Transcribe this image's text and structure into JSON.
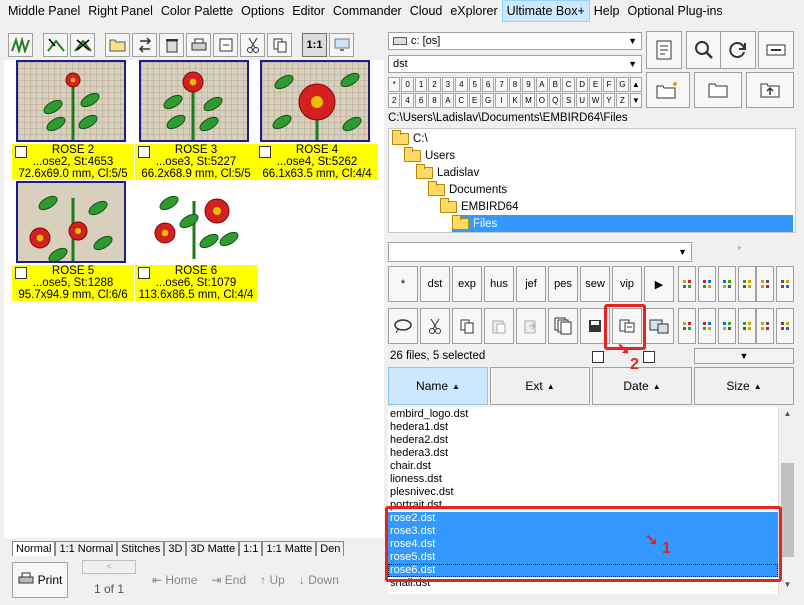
{
  "menu": {
    "items": [
      "Middle Panel",
      "Right Panel",
      "Color Palette",
      "Options",
      "Editor",
      "Commander",
      "Cloud",
      "eXplorer",
      "Ultimate Box+",
      "Help",
      "Optional Plug-ins"
    ],
    "active_index": 8
  },
  "left_toolbar": {
    "zoom_label": "1:1"
  },
  "thumbnails": [
    {
      "title": "ROSE 2",
      "line2": "...ose2, St:4653",
      "line3": "72.6x69.0 mm, Cl:5/5"
    },
    {
      "title": "ROSE 3",
      "line2": "...ose3, St:5227",
      "line3": "66.2x68.9 mm, Cl:5/5"
    },
    {
      "title": "ROSE 4",
      "line2": "...ose4, St:5262",
      "line3": "66.1x63.5 mm, Cl:4/4"
    },
    {
      "title": "ROSE 5",
      "line2": "...ose5, St:1288",
      "line3": "95.7x94.9 mm, Cl:6/6"
    },
    {
      "title": "ROSE 6",
      "line2": "...ose6, St:1079",
      "line3": "113.6x86.5 mm, Cl:4/4"
    }
  ],
  "bottom_tabs": [
    "Normal",
    "1:1 Normal",
    "Stitches",
    "3D",
    "3D Matte",
    "1:1",
    "1:1 Matte",
    "Den"
  ],
  "nav": {
    "print_label": "Print",
    "page_label": "1 of 1",
    "home_label": "Home",
    "end_label": "End",
    "up_label": "Up",
    "down_label": "Down"
  },
  "explorer": {
    "drive_value": "c: [os]",
    "ext_value": "dst",
    "filter_row1": [
      "*",
      "0",
      "1",
      "2",
      "3",
      "4",
      "5",
      "6",
      "7",
      "8",
      "9",
      "A",
      "B",
      "C",
      "D",
      "E",
      "F",
      "G",
      "▲"
    ],
    "filter_row2": [
      "2",
      "4",
      "6",
      "8",
      "A",
      "C",
      "E",
      "G",
      "I",
      "K",
      "M",
      "O",
      "Q",
      "S",
      "U",
      "W",
      "Y",
      "Z",
      "▼"
    ],
    "path": "C:\\Users\\Ladislav\\Documents\\EMBIRD64\\Files",
    "tree": [
      {
        "label": "C:\\",
        "level": 0
      },
      {
        "label": "Users",
        "level": 1
      },
      {
        "label": "Ladislav",
        "level": 2
      },
      {
        "label": "Documents",
        "level": 3
      },
      {
        "label": "EMBIRD64",
        "level": 4
      },
      {
        "label": "Files",
        "level": 5
      }
    ],
    "star": "*",
    "ext_buttons": [
      "*",
      "dst",
      "exp",
      "hus",
      "jef",
      "pes",
      "sew",
      "vip",
      "▶"
    ],
    "status": "26 files, 5 selected",
    "columns": [
      "Name",
      "Ext",
      "Date",
      "Size"
    ],
    "files": [
      "embird_logo.dst",
      "hedera1.dst",
      "hedera2.dst",
      "hedera3.dst",
      "chair.dst",
      "lioness.dst",
      "plesnivec.dst",
      "portrait.dst",
      "rose2.dst",
      "rose3.dst",
      "rose4.dst",
      "rose5.dst",
      "rose6.dst",
      "snail.dst"
    ],
    "selected_indices": [
      8,
      9,
      10,
      11,
      12
    ]
  },
  "annotations": {
    "label1": "1",
    "label2": "2"
  },
  "colors": {
    "selection": "#3399ff",
    "annotation": "#e8231f",
    "label_bg": "#ffff00"
  }
}
